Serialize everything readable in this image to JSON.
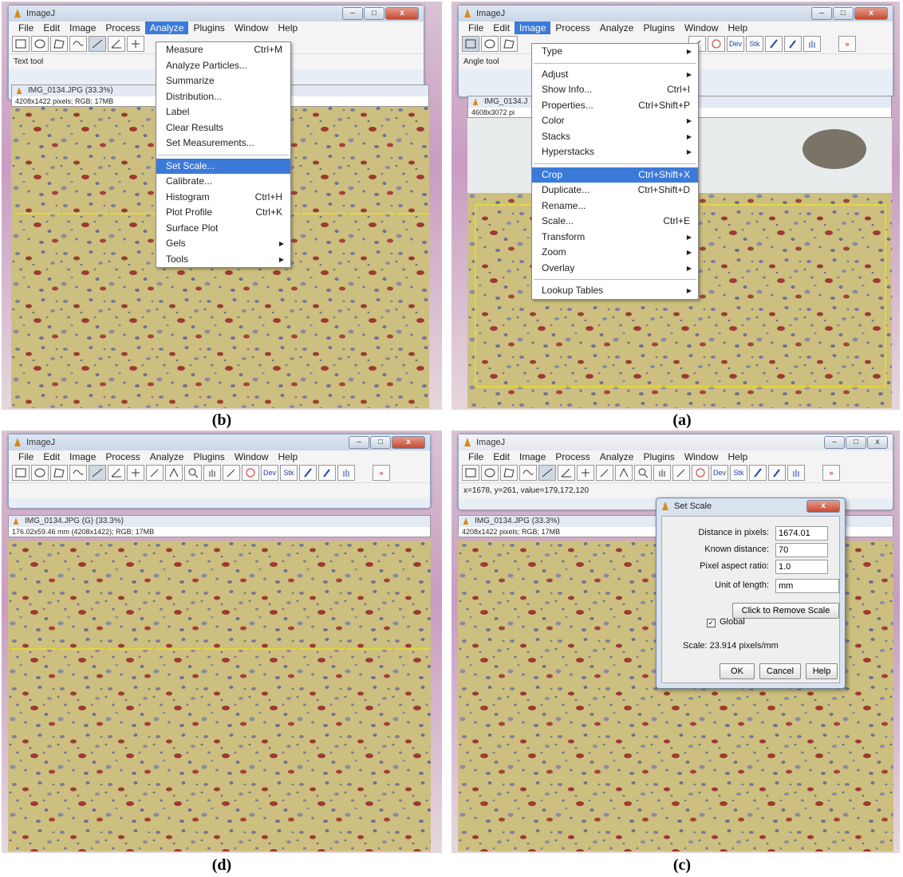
{
  "captions": {
    "b": "(b)",
    "a": "(a)",
    "d": "(d)",
    "c": "(c)"
  },
  "app_title": "ImageJ",
  "menus": [
    "File",
    "Edit",
    "Image",
    "Process",
    "Analyze",
    "Plugins",
    "Window",
    "Help"
  ],
  "tools": [
    "Dev",
    "Stk"
  ],
  "panel_b": {
    "status": "Text tool",
    "image_title": "IMG_0134.JPG (33.3%)",
    "image_info": "4208x1422 pixels; RGB; 17MB",
    "analyze_menu": [
      {
        "label": "Measure",
        "shortcut": "Ctrl+M"
      },
      {
        "label": "Analyze Particles..."
      },
      {
        "label": "Summarize"
      },
      {
        "label": "Distribution..."
      },
      {
        "label": "Label"
      },
      {
        "label": "Clear Results"
      },
      {
        "label": "Set Measurements..."
      },
      {
        "label": "Set Scale...",
        "highlighted": true
      },
      {
        "label": "Calibrate..."
      },
      {
        "label": "Histogram",
        "shortcut": "Ctrl+H"
      },
      {
        "label": "Plot Profile",
        "shortcut": "Ctrl+K"
      },
      {
        "label": "Surface Plot"
      },
      {
        "label": "Gels",
        "submenu": true
      },
      {
        "label": "Tools",
        "submenu": true
      }
    ]
  },
  "panel_a": {
    "status": "Angle tool",
    "image_title": "IMG_0134.J",
    "image_info": "4608x3072 pi",
    "image_menu": [
      {
        "label": "Type",
        "submenu": true
      },
      {
        "label": "Adjust",
        "submenu": true
      },
      {
        "label": "Show Info...",
        "shortcut": "Ctrl+I"
      },
      {
        "label": "Properties...",
        "shortcut": "Ctrl+Shift+P"
      },
      {
        "label": "Color",
        "submenu": true
      },
      {
        "label": "Stacks",
        "submenu": true
      },
      {
        "label": "Hyperstacks",
        "submenu": true
      },
      {
        "label": "Crop",
        "shortcut": "Ctrl+Shift+X",
        "highlighted": true
      },
      {
        "label": "Duplicate...",
        "shortcut": "Ctrl+Shift+D"
      },
      {
        "label": "Rename..."
      },
      {
        "label": "Scale...",
        "shortcut": "Ctrl+E"
      },
      {
        "label": "Transform",
        "submenu": true
      },
      {
        "label": "Zoom",
        "submenu": true
      },
      {
        "label": "Overlay",
        "submenu": true
      },
      {
        "label": "Lookup Tables",
        "submenu": true
      }
    ]
  },
  "panel_d": {
    "status": "",
    "image_title": "IMG_0134.JPG (G) (33.3%)",
    "image_info": "176.02x59.46 mm (4208x1422); RGB; 17MB"
  },
  "panel_c": {
    "status": "x=1678, y=261, value=179,172,120",
    "image_title": "IMG_0134.JPG (33.3%)",
    "image_info": "4208x1422 pixels; RGB; 17MB",
    "dialog": {
      "title": "Set Scale",
      "distance_label": "Distance in pixels:",
      "distance_value": "1674.01",
      "known_label": "Known distance:",
      "known_value": "70",
      "aspect_label": "Pixel aspect ratio:",
      "aspect_value": "1.0",
      "unit_label": "Unit of length:",
      "unit_value": "mm",
      "remove_button": "Click to Remove Scale",
      "global_label": "Global",
      "scale_text": "Scale: 23.914 pixels/mm",
      "ok": "OK",
      "cancel": "Cancel",
      "help": "Help"
    }
  }
}
